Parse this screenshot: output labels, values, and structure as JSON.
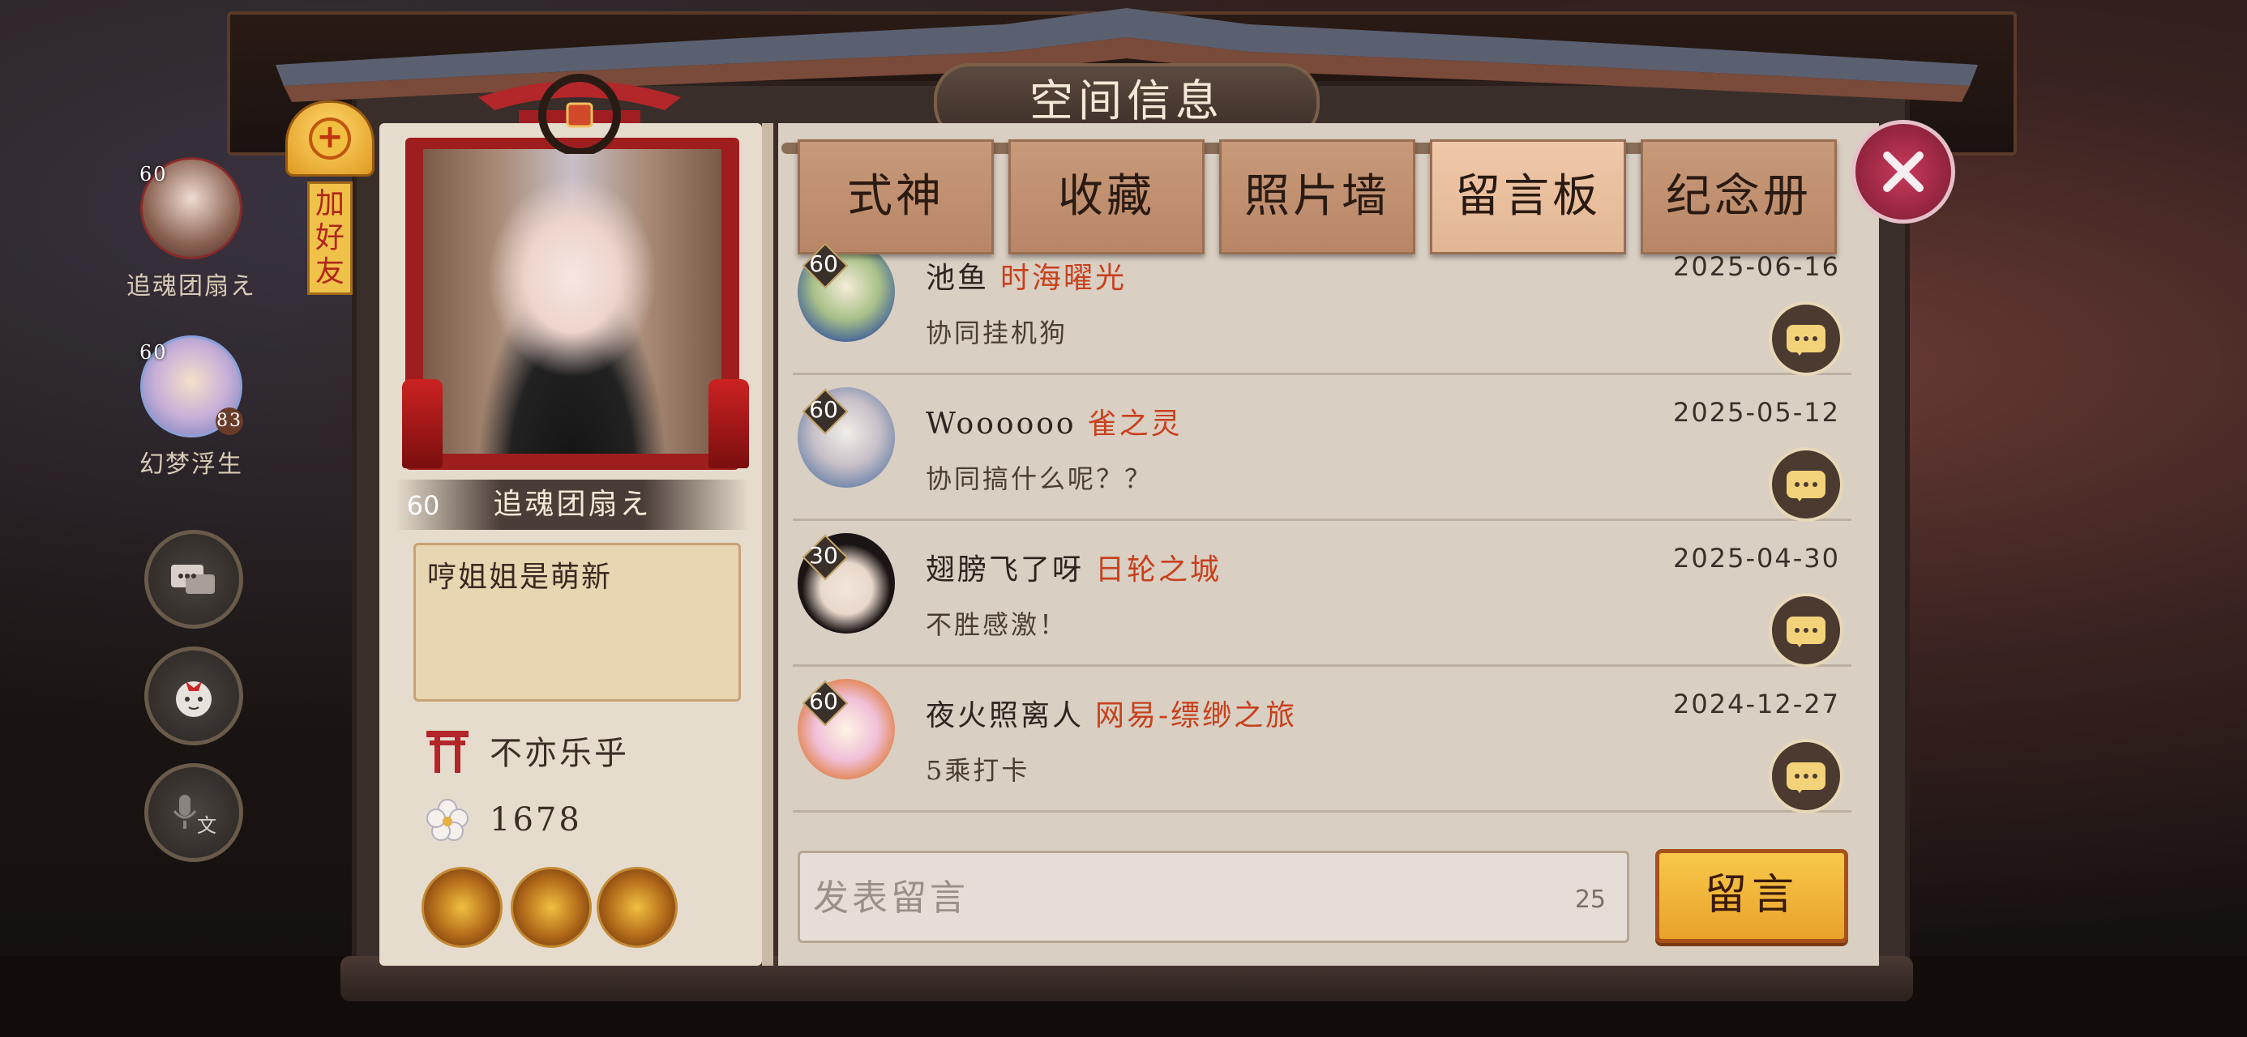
{
  "window": {
    "title": "空间信息"
  },
  "actions": {
    "add_friend_label": "加好友"
  },
  "side_friends": [
    {
      "level": "60",
      "name": "追魂团扇え"
    },
    {
      "level": "60",
      "badge": "83",
      "name": "幻梦浮生"
    }
  ],
  "side_buttons": [
    "chat-bubble-icon",
    "doll-face-icon",
    "voice-to-text-icon"
  ],
  "profile": {
    "level": "60",
    "name": "追魂团扇え",
    "signature": "哼姐姐是萌新",
    "guild": "不亦乐乎",
    "flowers": "1678",
    "badges": [
      "golden-dragon-badge",
      "gold-dragon-badge",
      "sun-medal-badge"
    ]
  },
  "tabs": [
    {
      "label": "式神",
      "active": false
    },
    {
      "label": "收藏",
      "active": false
    },
    {
      "label": "照片墙",
      "active": false
    },
    {
      "label": "留言板",
      "active": true
    },
    {
      "label": "纪念册",
      "active": false
    }
  ],
  "messages": [
    {
      "level": "60",
      "name": "池鱼",
      "server": "时海曜光",
      "date": "2025-06-16",
      "text": "协同挂机狗"
    },
    {
      "level": "60",
      "name": "Woooooo",
      "server": "雀之灵",
      "date": "2025-05-12",
      "text": "协同搞什么呢？？"
    },
    {
      "level": "30",
      "name": "翅膀飞了呀",
      "server": "日轮之城",
      "date": "2025-04-30",
      "text": "不胜感激！"
    },
    {
      "level": "60",
      "name": "夜火照离人",
      "server": "网易-缥缈之旅",
      "date": "2024-12-27",
      "text": "5乘打卡"
    }
  ],
  "compose": {
    "placeholder": "发表留言",
    "char_count": "25",
    "send_label": "留言"
  },
  "colors": {
    "server_name": "#c8401c",
    "active_tab": "#f0c8a8",
    "send_button": "#f8c84a",
    "close_button": "#c83a5c"
  }
}
